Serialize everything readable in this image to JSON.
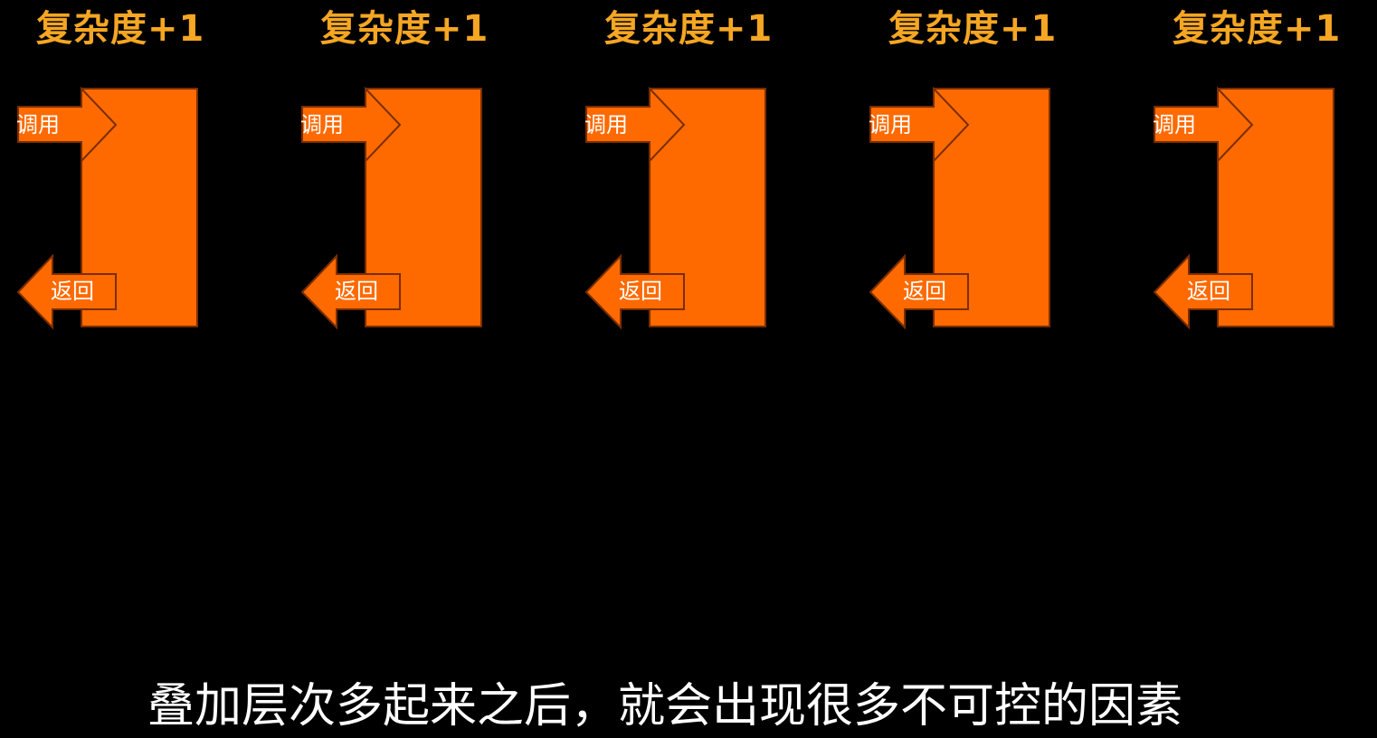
{
  "colors": {
    "background": "#000000",
    "title": "#f5a623",
    "frame_fill": "#ff6a00",
    "frame_stroke": "#7a2e00",
    "label_text": "#ffffff",
    "caption_text": "#ffffff"
  },
  "units": [
    {
      "title": "复杂度+1",
      "call_label": "调用",
      "return_label": "返回"
    },
    {
      "title": "复杂度+1",
      "call_label": "调用",
      "return_label": "返回"
    },
    {
      "title": "复杂度+1",
      "call_label": "调用",
      "return_label": "返回"
    },
    {
      "title": "复杂度+1",
      "call_label": "调用",
      "return_label": "返回"
    },
    {
      "title": "复杂度+1",
      "call_label": "调用",
      "return_label": "返回"
    }
  ],
  "caption": "叠加层次多起来之后，就会出现很多不可控的因素"
}
